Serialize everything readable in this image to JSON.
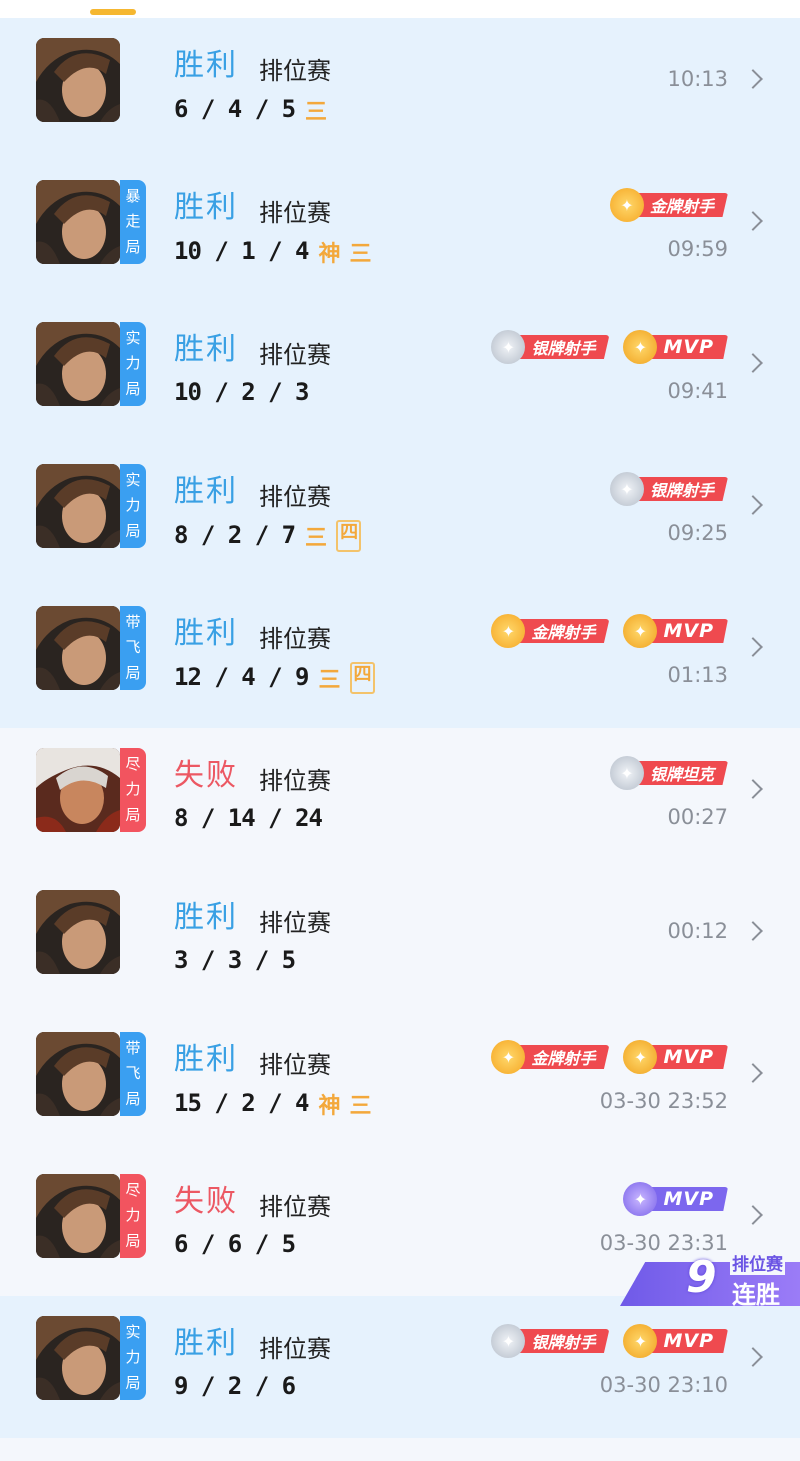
{
  "tab_indicator_color": "#f5b731",
  "matches": [
    {
      "result": "胜利",
      "outcome": "win",
      "type": "排位赛",
      "kda": "6 / 4 / 5",
      "marks": [
        "三"
      ],
      "tag": [],
      "tag_color": "",
      "badges": [],
      "time": "10:13",
      "hero": "hero-a"
    },
    {
      "result": "胜利",
      "outcome": "win",
      "type": "排位赛",
      "kda": "10 / 1 / 4",
      "marks": [
        "神",
        "三"
      ],
      "tag": [
        "暴",
        "走",
        "局"
      ],
      "tag_color": "blue",
      "badges": [
        {
          "kind": "gold",
          "text": "金牌射手"
        }
      ],
      "time": "09:59",
      "hero": "hero-a"
    },
    {
      "result": "胜利",
      "outcome": "win",
      "type": "排位赛",
      "kda": "10 / 2 / 3",
      "marks": [],
      "tag": [
        "实",
        "力",
        "局"
      ],
      "tag_color": "blue",
      "badges": [
        {
          "kind": "silver",
          "text": "银牌射手"
        },
        {
          "kind": "mvp-gold",
          "text": "MVP"
        }
      ],
      "time": "09:41",
      "hero": "hero-a"
    },
    {
      "result": "胜利",
      "outcome": "win",
      "type": "排位赛",
      "kda": "8 / 2 / 7",
      "marks": [
        "三",
        "四"
      ],
      "tag": [
        "实",
        "力",
        "局"
      ],
      "tag_color": "blue",
      "badges": [
        {
          "kind": "silver",
          "text": "银牌射手"
        }
      ],
      "time": "09:25",
      "hero": "hero-a"
    },
    {
      "result": "胜利",
      "outcome": "win",
      "type": "排位赛",
      "kda": "12 / 4 / 9",
      "marks": [
        "三",
        "四"
      ],
      "tag": [
        "带",
        "飞",
        "局"
      ],
      "tag_color": "blue",
      "badges": [
        {
          "kind": "gold",
          "text": "金牌射手"
        },
        {
          "kind": "mvp-gold",
          "text": "MVP"
        }
      ],
      "time": "01:13",
      "hero": "hero-a"
    },
    {
      "result": "失败",
      "outcome": "loss",
      "type": "排位赛",
      "kda": "8 / 14 / 24",
      "marks": [],
      "tag": [
        "尽",
        "力",
        "局"
      ],
      "tag_color": "red",
      "badges": [
        {
          "kind": "silver",
          "text": "银牌坦克"
        }
      ],
      "time": "00:27",
      "hero": "hero-b"
    },
    {
      "result": "胜利",
      "outcome": "win",
      "type": "排位赛",
      "kda": "3 / 3 / 5",
      "marks": [],
      "tag": [],
      "tag_color": "",
      "badges": [],
      "time": "00:12",
      "hero": "hero-a"
    },
    {
      "result": "胜利",
      "outcome": "win",
      "type": "排位赛",
      "kda": "15 / 2 / 4",
      "marks": [
        "神",
        "三"
      ],
      "tag": [
        "带",
        "飞",
        "局"
      ],
      "tag_color": "blue",
      "badges": [
        {
          "kind": "gold",
          "text": "金牌射手"
        },
        {
          "kind": "mvp-gold",
          "text": "MVP"
        }
      ],
      "time": "03-30 23:52",
      "hero": "hero-a"
    },
    {
      "result": "失败",
      "outcome": "loss",
      "type": "排位赛",
      "kda": "6 / 6 / 5",
      "marks": [],
      "tag": [
        "尽",
        "力",
        "局"
      ],
      "tag_color": "red",
      "badges": [
        {
          "kind": "mvp-purple",
          "text": "MVP"
        }
      ],
      "time": "03-30 23:31",
      "hero": "hero-a"
    },
    {
      "result": "胜利",
      "outcome": "win",
      "type": "排位赛",
      "kda": "9 / 2 / 6",
      "marks": [],
      "tag": [
        "实",
        "力",
        "局"
      ],
      "tag_color": "blue",
      "badges": [
        {
          "kind": "silver",
          "text": "银牌射手"
        },
        {
          "kind": "mvp-gold",
          "text": "MVP"
        }
      ],
      "time": "03-30 23:10",
      "hero": "hero-a"
    }
  ],
  "row_backgrounds": [
    "win",
    "win",
    "win",
    "win",
    "win",
    "plain",
    "plain",
    "plain",
    "plain",
    "win"
  ],
  "streak": {
    "count": "9",
    "title": "排位赛",
    "label": "连胜"
  }
}
